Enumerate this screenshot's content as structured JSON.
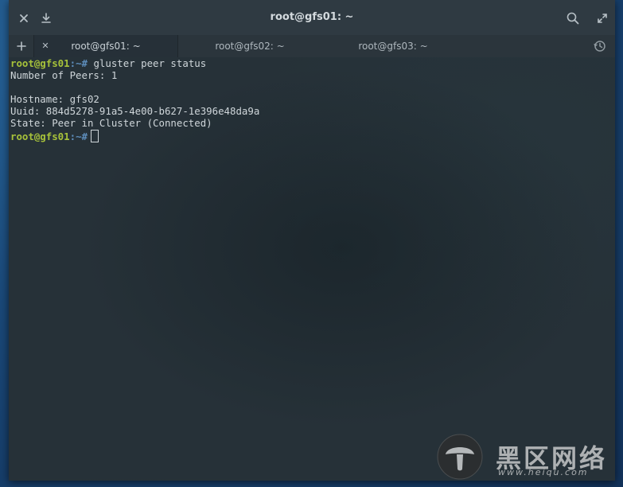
{
  "window": {
    "title": "root@gfs01: ~"
  },
  "toolbar": {
    "close_icon": "close-icon",
    "download_icon": "download-icon",
    "search_icon": "search-icon",
    "fullscreen_icon": "fullscreen-icon"
  },
  "tabs": [
    {
      "label": "root@gfs01: ~",
      "active": true
    },
    {
      "label": "root@gfs02: ~",
      "active": false
    },
    {
      "label": "root@gfs03: ~",
      "active": false
    }
  ],
  "terminal": {
    "prompt_user": "root@gfs01",
    "prompt_path": ":~#",
    "command": " gluster peer status",
    "output": [
      "Number of Peers: 1",
      "",
      "Hostname: gfs02",
      "Uuid: 884d5278-91a5-4e00-b627-1e396e48da9a",
      "State: Peer in Cluster (Connected)"
    ]
  },
  "watermark": {
    "text": "黑区网络",
    "url": "www.heiqu.com"
  },
  "colors": {
    "titlebar": "#2f3a42",
    "terminal_bg": "#263138",
    "prompt_user": "#a7c23a",
    "prompt_path": "#5d8dbb",
    "text": "#cfd6da"
  }
}
